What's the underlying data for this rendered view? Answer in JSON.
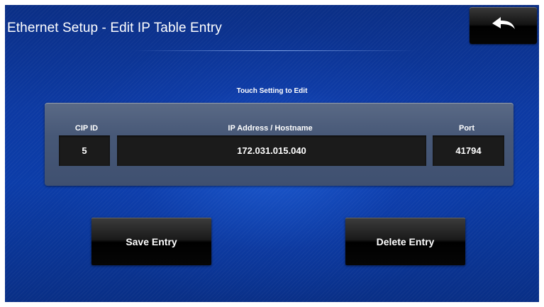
{
  "header": {
    "title": "Ethernet Setup - Edit IP Table Entry",
    "back_icon": "back-arrow-icon"
  },
  "hint": "Touch Setting to Edit",
  "entry": {
    "columns": {
      "cip_id": "CIP ID",
      "ip_address": "IP Address / Hostname",
      "port": "Port"
    },
    "values": {
      "cip_id": "5",
      "ip_address": "172.031.015.040",
      "port": "41794"
    }
  },
  "actions": {
    "save_label": "Save Entry",
    "delete_label": "Delete Entry"
  },
  "colors": {
    "background": "#0c3da9",
    "panel": "#475877",
    "field": "#1b1b1b",
    "button": "#000000"
  }
}
